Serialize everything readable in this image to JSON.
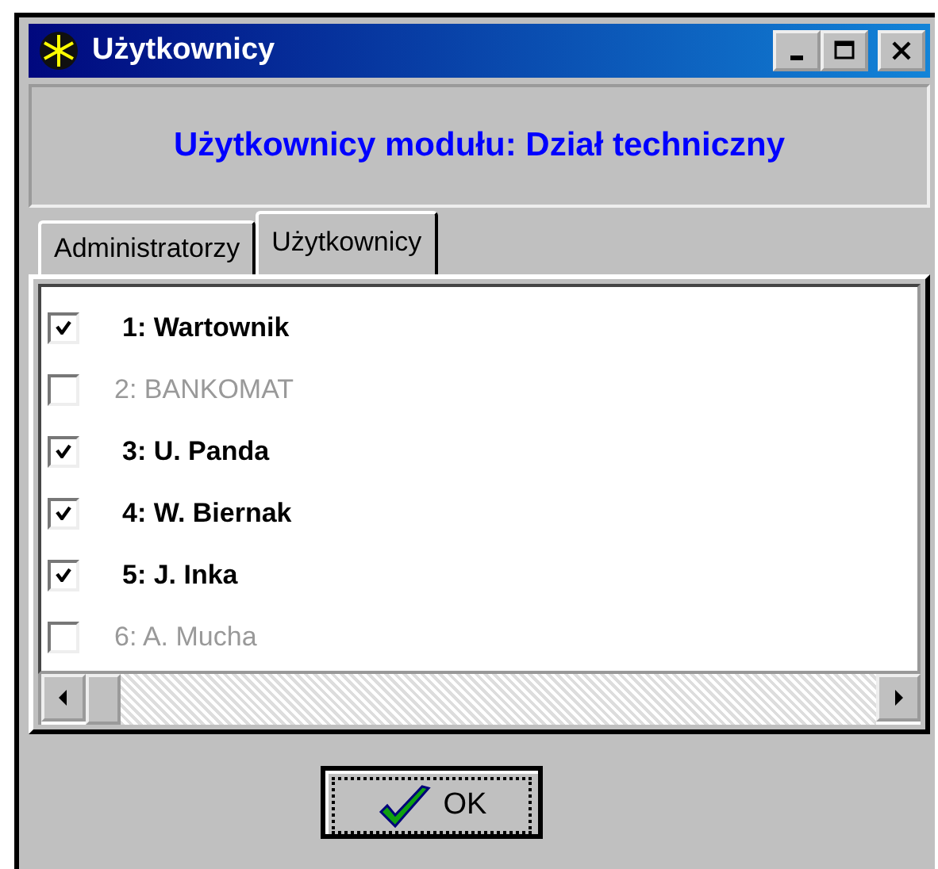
{
  "window": {
    "title": "Użytkownicy"
  },
  "header": "Użytkownicy modułu: Dział techniczny",
  "tabs": [
    {
      "label": "Administratorzy",
      "selected": false
    },
    {
      "label": "Użytkownicy",
      "selected": true
    }
  ],
  "users": [
    {
      "label": "1: Wartownik",
      "checked": true
    },
    {
      "label": "2: BANKOMAT",
      "checked": false
    },
    {
      "label": "3: U. Panda",
      "checked": true
    },
    {
      "label": "4: W. Biernak",
      "checked": true
    },
    {
      "label": "5: J. Inka",
      "checked": true
    },
    {
      "label": "6: A. Mucha",
      "checked": false
    }
  ],
  "buttons": [
    "OK"
  ]
}
